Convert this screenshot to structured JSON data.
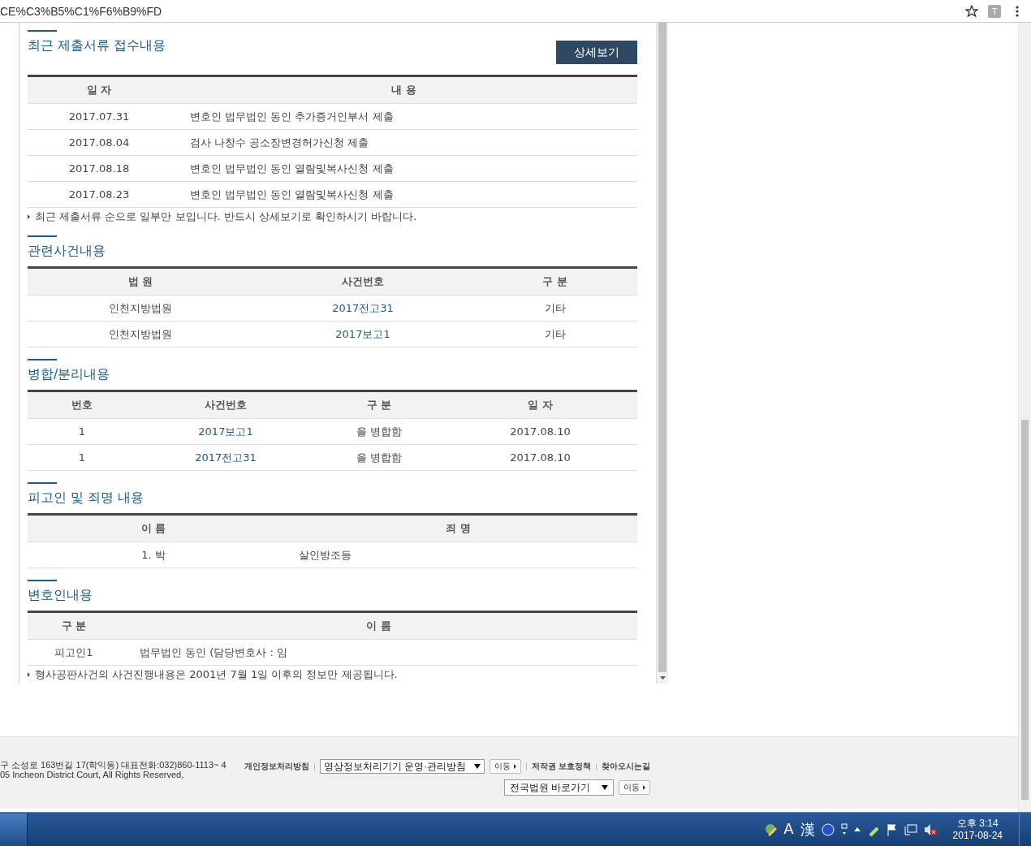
{
  "address_bar": {
    "url": "CE%C3%B5%C1%F6%B9%FD",
    "extension_label": "T"
  },
  "sections": [
    {
      "title": "최근 제출서류 접수내용",
      "button": "상세보기",
      "columns": [
        "일 자",
        "내 용"
      ],
      "rows": [
        [
          {
            "text": "2017.07.31",
            "kind": "text"
          },
          {
            "text": "변호인 법무법인 동인 추가증거인부서 제출",
            "kind": "text"
          }
        ],
        [
          {
            "text": "2017.08.04",
            "kind": "text"
          },
          {
            "text": "검사 나창수 공소장변경허가신청 제출",
            "kind": "text"
          }
        ],
        [
          {
            "text": "2017.08.18",
            "kind": "text"
          },
          {
            "text": "변호인 법무법인 동인 열람및복사신청 제출",
            "kind": "text"
          }
        ],
        [
          {
            "text": "2017.08.23",
            "kind": "text"
          },
          {
            "text": "변호인 법무법인 동인 열람및복사신청 제출",
            "kind": "text"
          }
        ]
      ],
      "note": "최근 제출서류 순으로 일부만 보입니다. 반드시 상세보기로 확인하시기 바랍니다."
    },
    {
      "title": "관련사건내용",
      "columns": [
        "법 원",
        "사건번호",
        "구 분"
      ],
      "rows": [
        [
          {
            "text": "인천지방법원",
            "kind": "text"
          },
          {
            "text": "2017전고31",
            "kind": "link"
          },
          {
            "text": "기타",
            "kind": "text"
          }
        ],
        [
          {
            "text": "인천지방법원",
            "kind": "text"
          },
          {
            "text": "2017보고1",
            "kind": "link"
          },
          {
            "text": "기타",
            "kind": "text"
          }
        ]
      ]
    },
    {
      "title": "병합/분리내용",
      "columns": [
        "번호",
        "사건번호",
        "구 분",
        "일 자"
      ],
      "rows": [
        [
          {
            "text": "1",
            "kind": "text"
          },
          {
            "text": "2017보고1",
            "kind": "link"
          },
          {
            "text": "을 병합함",
            "kind": "text"
          },
          {
            "text": "2017.08.10",
            "kind": "text"
          }
        ],
        [
          {
            "text": "1",
            "kind": "text"
          },
          {
            "text": "2017전고31",
            "kind": "link"
          },
          {
            "text": "을 병합함",
            "kind": "text"
          },
          {
            "text": "2017.08.10",
            "kind": "text"
          }
        ]
      ]
    },
    {
      "title": "피고인 및 죄명 내용",
      "columns": [
        "이 름",
        "죄 명"
      ],
      "rows": [
        [
          {
            "text": "1. 박",
            "kind": "text"
          },
          {
            "text": "살인방조등",
            "kind": "text"
          }
        ]
      ]
    },
    {
      "title": "변호인내용",
      "columns": [
        "구 분",
        "이 름"
      ],
      "rows": [
        [
          {
            "text": "피고인1",
            "kind": "text"
          },
          {
            "text": "법무법인 동인 (담당변호사 : 임",
            "kind": "text"
          }
        ]
      ],
      "note": "형사공판사건의 사건진행내용은 2001년 7월 1일 이후의 정보만 제공됩니다."
    }
  ],
  "footer": {
    "address": "구 소성로 163번길 17(학익동) 대표전화:032)860-1113~ 4",
    "copyright": "05 Incheon District Court, All Rights Reserved,",
    "policy_link": "개인정보처리방침",
    "policy_select": "영상정보처리기기 운영·관리방침",
    "go_button": "이동",
    "copyright_link": "저작권 보호정책",
    "directions_link": "찾아오시는길",
    "court_select": "전국법원 바로가기",
    "court_go_button": "이동"
  },
  "taskbar": {
    "ime_mode": "A",
    "ime_hanja": "漢",
    "time": "오후 3:14",
    "date": "2017-08-24"
  }
}
